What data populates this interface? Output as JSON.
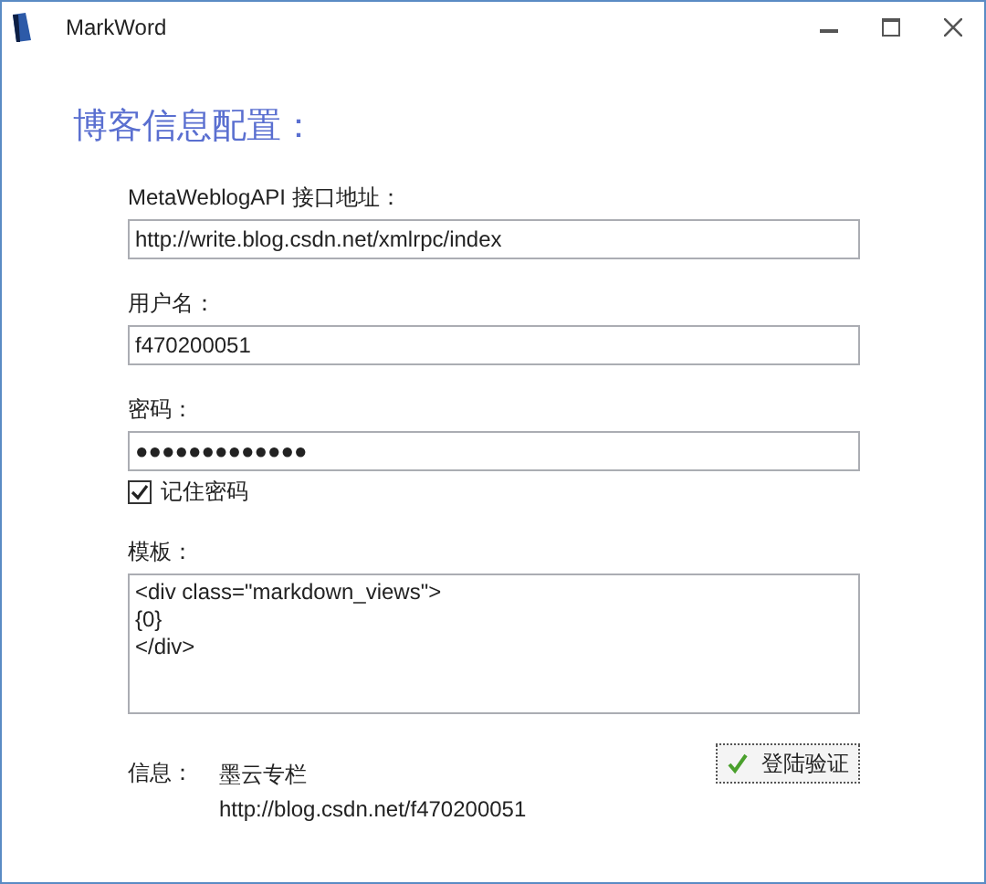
{
  "window": {
    "title": "MarkWord"
  },
  "heading": "博客信息配置：",
  "fields": [
    {
      "kind": "text",
      "label": "MetaWeblogAPI 接口地址：",
      "value": "http://write.blog.csdn.net/xmlrpc/index"
    },
    {
      "kind": "text",
      "label": "用户名：",
      "value": "f470200051"
    },
    {
      "kind": "text",
      "label": "密码：",
      "value": "●●●●●●●●●●●●●"
    },
    {
      "kind": "checkbox",
      "label": "记住密码",
      "checked": true
    },
    {
      "kind": "multiline",
      "label": "模板：",
      "value": "<div class=\"markdown_views\">\n{0}\n</div>"
    }
  ],
  "info": {
    "label": "信息：",
    "lines": [
      "墨云专栏",
      "http://blog.csdn.net/f470200051"
    ]
  },
  "button": "登陆验证"
}
